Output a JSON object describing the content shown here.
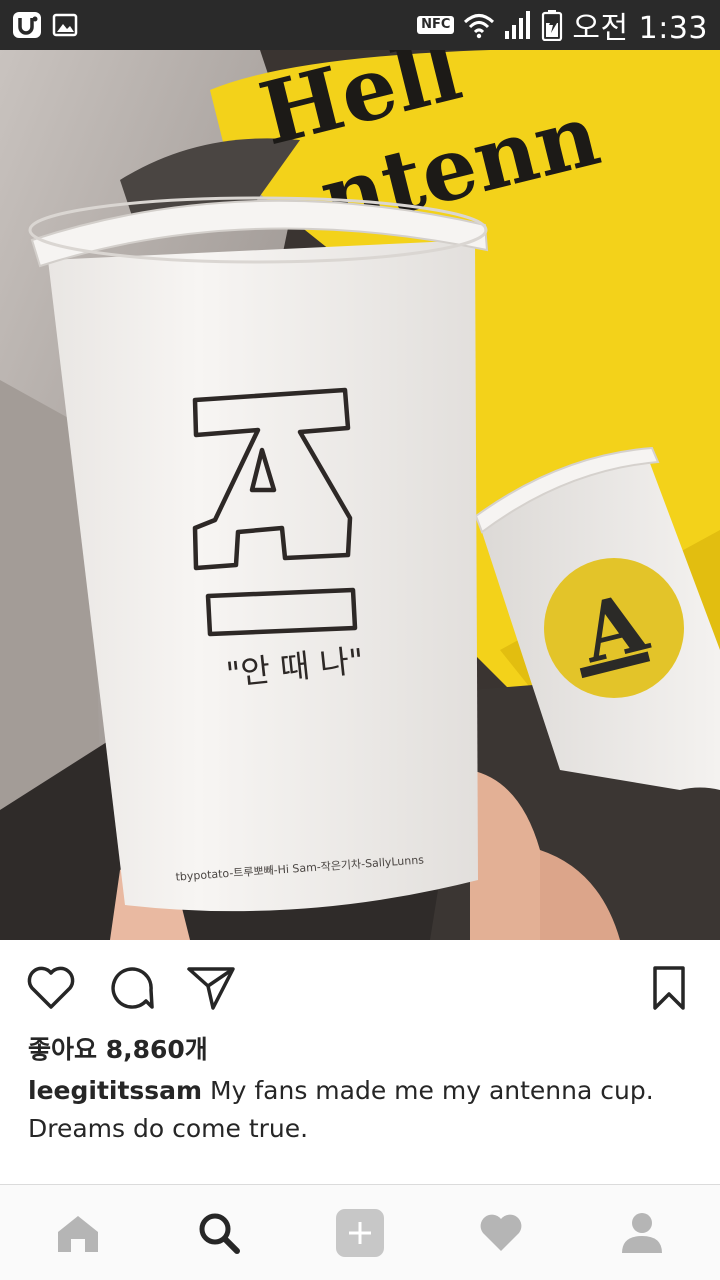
{
  "status_bar": {
    "nfc_label": "NFC",
    "time": "오전 1:33",
    "left_icons": [
      "u-plus-icon",
      "gallery-icon"
    ],
    "right_icons": [
      "wifi-icon",
      "signal-icon",
      "battery-icon"
    ]
  },
  "photo": {
    "pillow_text_top": "Hell",
    "pillow_text_bottom": "ntenn",
    "cup_big_letter": "A",
    "cup_hangul": "\"안 때 나\"",
    "cup_footer": "tbypotato-트루뽀빼-Hi Sam-작은기차-SallyLunns",
    "cup_small_letter": "A"
  },
  "actions": {
    "icons": [
      "heart-icon",
      "comment-icon",
      "share-icon",
      "bookmark-icon"
    ]
  },
  "post": {
    "likes": "좋아요 8,860개",
    "username": "leegititssam",
    "caption_text": " My fans made me my antenna cup. Dreams do come true."
  },
  "bottom_nav": {
    "items": [
      "home-icon",
      "search-icon",
      "add-icon",
      "activity-icon",
      "profile-icon"
    ]
  },
  "colors": {
    "status_bar": "#2a2a2a",
    "pillow_yellow": "#f3d21a",
    "text": "#262626",
    "nav_inactive": "#b5b5b5",
    "nav_active": "#262626"
  }
}
